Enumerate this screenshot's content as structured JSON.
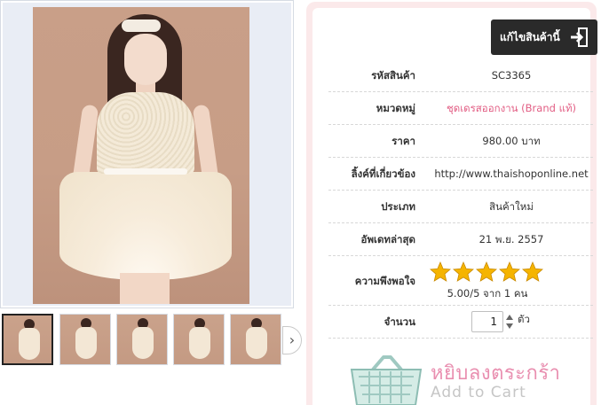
{
  "gallery": {
    "main_image": "dress-photo",
    "thumbnails": [
      {
        "name": "thumbnail-1",
        "active": true
      },
      {
        "name": "thumbnail-2",
        "active": false
      },
      {
        "name": "thumbnail-3",
        "active": false
      },
      {
        "name": "thumbnail-4",
        "active": false
      },
      {
        "name": "thumbnail-5",
        "active": false
      }
    ],
    "next_icon": "chevron-right-icon",
    "next_glyph": "›"
  },
  "toolbar": {
    "edit_label": "แก้ไขสินค้านี้",
    "edit_icon": "exit-door-icon"
  },
  "product": {
    "rows": [
      {
        "key": "รหัสสินค้า",
        "value": "SC3365"
      },
      {
        "key": "หมวดหมู่",
        "value": "ชุดเดรสออกงาน (Brand แท้)"
      },
      {
        "key": "ราคา",
        "value": "980.00 บาท"
      },
      {
        "key": "ลิ้งค์ที่เกี่ยวข้อง",
        "value": "http://www.thaishoponline.net"
      },
      {
        "key": "ประเภท",
        "value": "สินค้าใหม่"
      },
      {
        "key": "อัพเดทล่าสุด",
        "value": "21 พ.ย. 2557"
      }
    ],
    "rating": {
      "label": "ความพึงพอใจ",
      "stars": 5,
      "max": 5,
      "text": "5.00/5 จาก 1 คน"
    },
    "quantity": {
      "label": "จำนวน",
      "value": "1",
      "unit": "ตัว"
    }
  },
  "cart": {
    "label_th": "หยิบลงตระกร้า",
    "label_en": "Add to Cart",
    "icon": "basket-icon"
  },
  "colors": {
    "panel_border": "#fbe9ea",
    "accent_pink": "#e25e84",
    "star": "#f5b400",
    "edit_button": "#2a2a2a"
  }
}
